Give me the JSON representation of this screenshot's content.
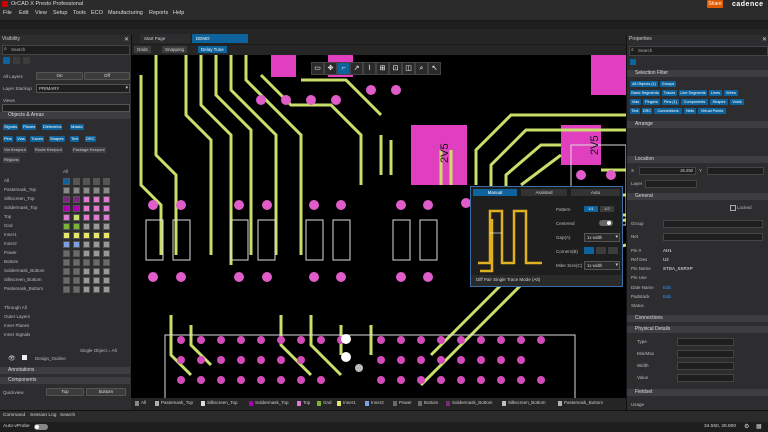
{
  "window": {
    "title": "OrCAD X Presto Professional",
    "share": "Share",
    "brand": "cadence"
  },
  "menu": [
    "File",
    "Edit",
    "View",
    "Setup",
    "Tools",
    "ECO",
    "Manufacturing",
    "Reports",
    "Help"
  ],
  "doc_tabs": [
    "Start Page",
    "DEMO"
  ],
  "view_tabs": [
    "Grids",
    "Snapping",
    "Delay Tune"
  ],
  "visibility": {
    "title": "Visibility",
    "search_placeholder": "Search",
    "all_layers": "All Layers",
    "on": "On",
    "off": "Off",
    "layer_stackup_label": "Layer Stackup",
    "layer_stackup_value": "PRIMARY",
    "views_label": "Views",
    "objects_section": "Objects & Areas",
    "object_chips": [
      "Signals",
      "Planes",
      "Dielectrics",
      "Masks",
      "Pins",
      "Vias",
      "Traces",
      "Shapes",
      "Text",
      "DRC",
      "Via Keepout",
      "Route Keepout",
      "Package Keepout",
      "Regions"
    ],
    "col_header": "All",
    "layers": [
      "All",
      "Pastemask_Top",
      "Silkscreen_Top",
      "Soldermask_Top",
      "Top",
      "Gnd",
      "Inner1",
      "Inner2",
      "Power",
      "Bottom",
      "Soldermask_Bottom",
      "Silkscreen_Bottom",
      "Pastemask_Bottom"
    ],
    "extras": [
      "Through All",
      "Outer Layers",
      "Inner Planes",
      "Inner Signals"
    ],
    "single_object": "Single Object = Alt",
    "design_outline": "Design_Outline",
    "annotations": "Annotations",
    "components": "Components",
    "quickview": "Quickview",
    "top_btn": "Top",
    "bottom_btn": "Bottom"
  },
  "canvas": {
    "label_2v5": "2V5"
  },
  "popup": {
    "tabs": [
      "Manual",
      "Assisted",
      "Auto"
    ],
    "pattern_label": "Pattern",
    "pattern_opts": [
      "1/1",
      "1/2"
    ],
    "centered_label": "Centered",
    "gap_label": "Gap(A)",
    "gap_value": "1x width",
    "corners_label": "Corners(B)",
    "miter_label": "Miter Size(C)",
    "miter_value": "1x width",
    "footer": "Diff Pair Single Trace Mode (Alt)"
  },
  "layer_tabs": [
    "All",
    "Pastemask_Top",
    "Silkscreen_Top",
    "Soldermask_Top",
    "Top",
    "Gnd",
    "Inner1",
    "Inner2",
    "Power",
    "Bottom",
    "Soldermask_Bottom",
    "Silkscreen_Bottom",
    "Pastemask_Bottom"
  ],
  "properties": {
    "title": "Properties",
    "search_placeholder": "Search",
    "selection_filter": "Selection Filter",
    "filter_chips": [
      "All Objects (1)",
      "Groups",
      "Basic Segments",
      "Traces",
      "Line Segments",
      "Lines",
      "Wires",
      "Vias",
      "Fingers",
      "Pins (1)",
      "Components",
      "Shapes",
      "Voids",
      "Text",
      "DRC",
      "Connections",
      "Nets",
      "Virtual Points"
    ],
    "arrange": "Arrange",
    "location": "Location",
    "x_label": "X",
    "y_label": "Y",
    "x_value": "26.250",
    "layer_label": "Layer",
    "general": "General",
    "locked": "Locked",
    "group_label": "Group",
    "net_label": "Net",
    "pin_label": "Pin #",
    "pin_value": "AH1",
    "ref_label": "Ref Des",
    "ref_value": "U2",
    "pinname_label": "Pin Name",
    "pinname_value": "STDA_SSRXP",
    "pinuse_label": "Pin Use",
    "datename_label": "Date Name",
    "datename_value": "Edit",
    "padstack_label": "Padstack",
    "padstack_value": "Edit",
    "status_label": "Status",
    "connections": "Connections",
    "connections_value": "None",
    "physical": "Physical Details",
    "type_label": "Type",
    "minmax_label": "Min/Max",
    "width_label": "Width",
    "value_label": "Value",
    "fieldset": "Fieldset",
    "usage_label": "Usage"
  },
  "bottom_tabs": [
    "Command",
    "Session Log",
    "Search"
  ],
  "status": {
    "autovprobe": "Auto-vProbe",
    "coords": "34.550, 28.800"
  },
  "colors": {
    "accent": "#0e639c",
    "pin": "#e05cc8",
    "trace": "#c8e06a",
    "copper_pad": "#e040c0"
  }
}
